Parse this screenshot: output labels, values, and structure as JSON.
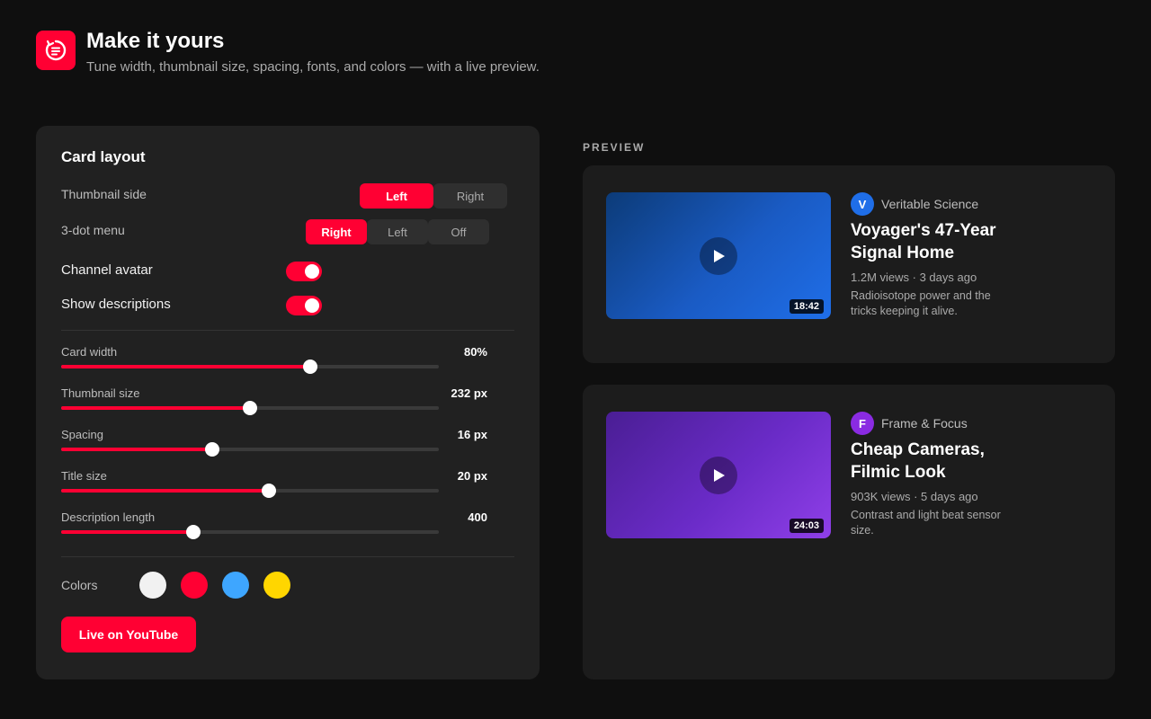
{
  "header": {
    "title": "Make it yours",
    "subtitle": "Tune width, thumbnail size, spacing, fonts, and colors — with a live preview."
  },
  "settings": {
    "title": "Card layout",
    "thumbnail_side": {
      "label": "Thumbnail side",
      "options": [
        "Left",
        "Right"
      ],
      "selected": "Left"
    },
    "three_dot_menu": {
      "label": "3-dot menu",
      "options": [
        "Right",
        "Left",
        "Off"
      ],
      "selected": "Right"
    },
    "toggles": [
      {
        "label": "Channel avatar",
        "on": true
      },
      {
        "label": "Show descriptions",
        "on": true
      }
    ],
    "sliders": [
      {
        "label": "Card width",
        "value_text": "80%",
        "fraction": 0.66
      },
      {
        "label": "Thumbnail size",
        "value_text": "232 px",
        "fraction": 0.5
      },
      {
        "label": "Spacing",
        "value_text": "16 px",
        "fraction": 0.4
      },
      {
        "label": "Title size",
        "value_text": "20 px",
        "fraction": 0.55
      },
      {
        "label": "Description length",
        "value_text": "400",
        "fraction": 0.35
      }
    ],
    "colors": {
      "label": "Colors",
      "swatches": [
        "#f1f1f1",
        "#ff0033",
        "#3ea6ff",
        "#ffd600"
      ]
    },
    "live_button": "Live on YouTube"
  },
  "preview": {
    "heading": "PREVIEW",
    "videos": [
      {
        "channel_initial": "V",
        "channel_color": "#1f6ee8",
        "channel": "Veritable Science",
        "title": "Voyager's 47-Year Signal Home",
        "meta": "1.2M views · 3 days ago",
        "description": "Radioisotope power and the tricks keeping it alive.",
        "duration": "18:42"
      },
      {
        "channel_initial": "F",
        "channel_color": "#8a2be2",
        "channel": "Frame & Focus",
        "title": "Cheap Cameras, Filmic Look",
        "meta": "903K views · 5 days ago",
        "description": "Contrast and light beat sensor size.",
        "duration": "24:03"
      }
    ]
  },
  "colors": {
    "accent": "#ff0033",
    "background": "#0f0f0f",
    "panel": "#212121"
  },
  "icons": {
    "logo": "refresh-list-icon",
    "play": "play-icon"
  }
}
